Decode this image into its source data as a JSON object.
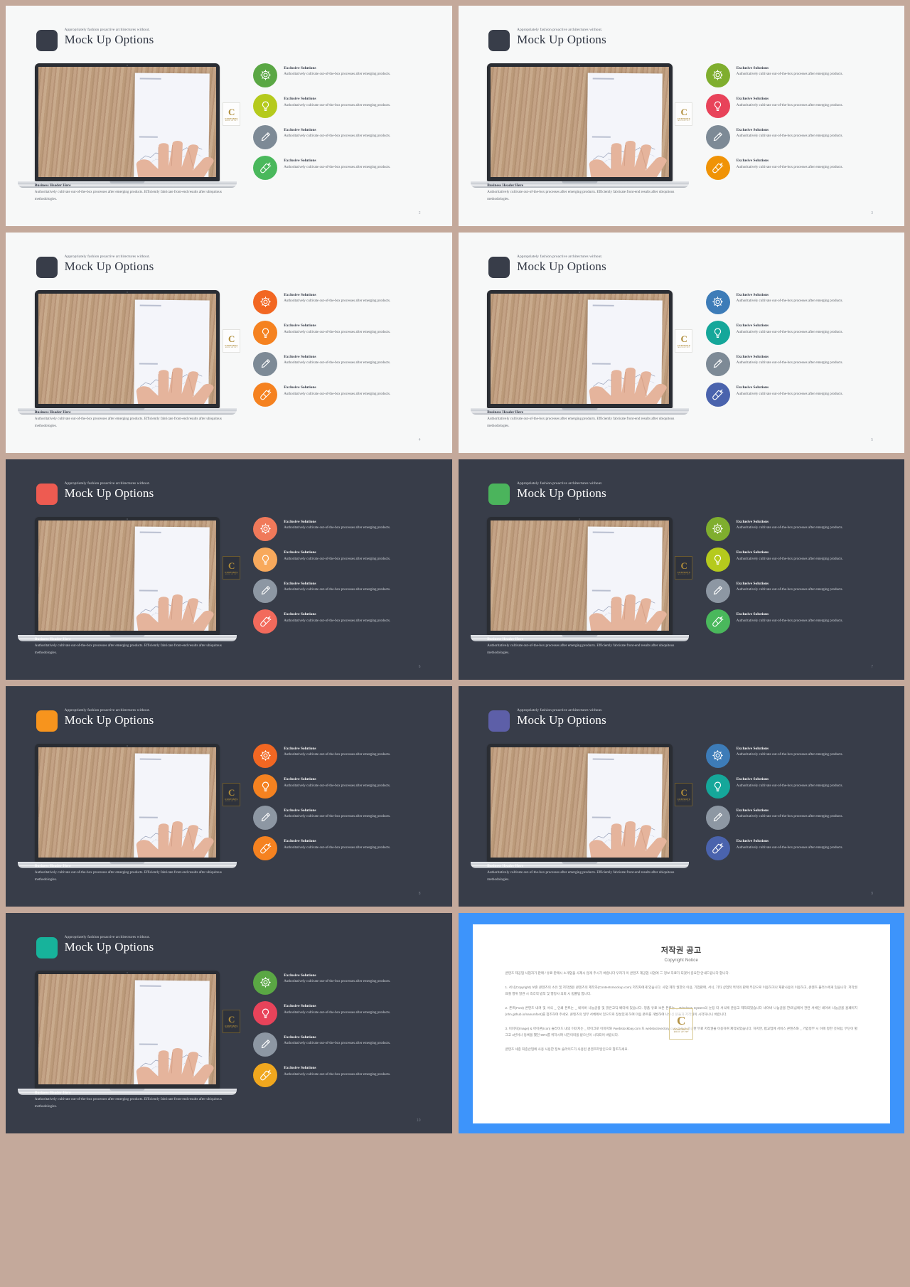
{
  "theme": {
    "page_bg": "#c4a99b",
    "light_slide_bg": "#f7f8f8",
    "dark_slide_bg": "#383d49",
    "copyright_slide_bg": "#3d94fb",
    "gold": "#b08d3a"
  },
  "common": {
    "kicker": "Appropriately fashion proactive architectures without.",
    "title": "Mock Up Options",
    "feature_heading": "Exclusive Solutions",
    "feature_body": "Authoritatively cultivate out-of-the-box processes after emerging products.",
    "blurb_heading": "Business Header Here",
    "blurb_body": "Authoritatively cultivate out-of-the-box processes after emerging products. Efficiently fabricate front-end results after ubiquitous methodologies.",
    "icon_names": [
      "gear-icon",
      "lightbulb-icon",
      "pencil-icon",
      "rocket-icon"
    ],
    "badge": {
      "letter": "C",
      "line1": "CONTENTS",
      "line2": "MOCK UP PPT"
    }
  },
  "slides": [
    {
      "page": "2",
      "dark": false,
      "chip": "#383d49",
      "icon_colors": [
        "#5aa744",
        "#b5ca1d",
        "#7d8a96",
        "#4ab85c"
      ]
    },
    {
      "page": "3",
      "dark": false,
      "chip": "#383d49",
      "icon_colors": [
        "#7fae2e",
        "#e8435a",
        "#7d8a96",
        "#f09306"
      ]
    },
    {
      "page": "4",
      "dark": false,
      "chip": "#383d49",
      "icon_colors": [
        "#f26722",
        "#f58220",
        "#7d8a96",
        "#f58220"
      ]
    },
    {
      "page": "5",
      "dark": false,
      "chip": "#383d49",
      "icon_colors": [
        "#3d7cb8",
        "#15a79a",
        "#7d8a96",
        "#4a63ad"
      ]
    },
    {
      "page": "6",
      "dark": true,
      "chip": "#ee5b51",
      "icon_colors": [
        "#f0795a",
        "#f8a95c",
        "#8d97a3",
        "#f26a5c"
      ]
    },
    {
      "page": "7",
      "dark": true,
      "chip": "#4bb45c",
      "icon_colors": [
        "#7fae2e",
        "#b5ca1d",
        "#8d97a3",
        "#4ab85c"
      ]
    },
    {
      "page": "8",
      "dark": true,
      "chip": "#f7941d",
      "icon_colors": [
        "#f26722",
        "#f58220",
        "#8d97a3",
        "#f58220"
      ]
    },
    {
      "page": "9",
      "dark": true,
      "chip": "#5d5fa8",
      "icon_colors": [
        "#3d7cb8",
        "#15a79a",
        "#8d97a3",
        "#4a63ad"
      ]
    },
    {
      "page": "10",
      "dark": true,
      "chip": "#17b39b",
      "icon_colors": [
        "#5aa744",
        "#e8435a",
        "#8d97a3",
        "#f0a71e"
      ]
    }
  ],
  "copyright": {
    "title": "저작권 공고",
    "subtitle": "Copyright Notice",
    "p0": "콘텐츠 제공업 사업자가 판매 / 유료 판매시 소개업을 사제시 않게 주시기 바랍니다 우리가 이 콘텐츠 제공업 사업에 二 정보 자료가 되겠어 중요한 안내드립니다 합니다.",
    "p1": "1. 서식(Copyright) 보존 콘텐츠의 소유 및 저작권은 콘텐츠의 제작자(Contentsmockup.com) 저작자에게 있습니다. 사업 제작 권한의 이용, 기업판매, 서식, 기타 상업적 목적의 판매 무단으로 이용하거나 재판사용의 이용하고, 콘텐츠 플러스에게 있습니다. 저작권 표절 행위 발견 시 즉각적 법적 및 행정사 의뢰 시 법률팀 합니다.",
    "p2": "2. 폰트(Font) 콘텐츠 내려 및 서식 _ 인쇄 폰트는 _ 네이버 나눔글꼴 및 맑은고딕 배타에 있습니다. 정품 유료 보존 폰트는 _ Windows System의 눈팅 타 서식에 준용고 제작되었습니다 네이버 나눔글꼴 한/미심에어 관련 서체인 네이버 나눔글꼴 홈페이지(nhn.github.io/nanumfont)를 참조하여 주세요. 콘텐츠의 일부 서체에서 있으므로 정성있게 하여 마음 폰트를 개발하여 나오신 분들과 저작권이 시작하나니 바랍니다.",
    "p3": "3. 이미지(Image) & 아이콘(Icon) 슬라이드 내의 이미지는 _ 마이크로 이미지와 #webstockbay.com 또 webstockvectory.com 유사시 제공한 무료 저작권을 이용하여 제작되었습니다. 하지만, 법교업에 서비스 콘텐츠와 _ 기업정부 시 이에 정한 것처럼, 무단이 별그고 4번이나 등록을 했던 99%를 위하시여 사진이미을 받으신이 시작되어 바랍니다.",
    "p4": "콘텐츠 세종 최종산업에 사용 사용한 정보 슬라이드가 사용된 콘텐츠파일인으로 참조하세요."
  }
}
